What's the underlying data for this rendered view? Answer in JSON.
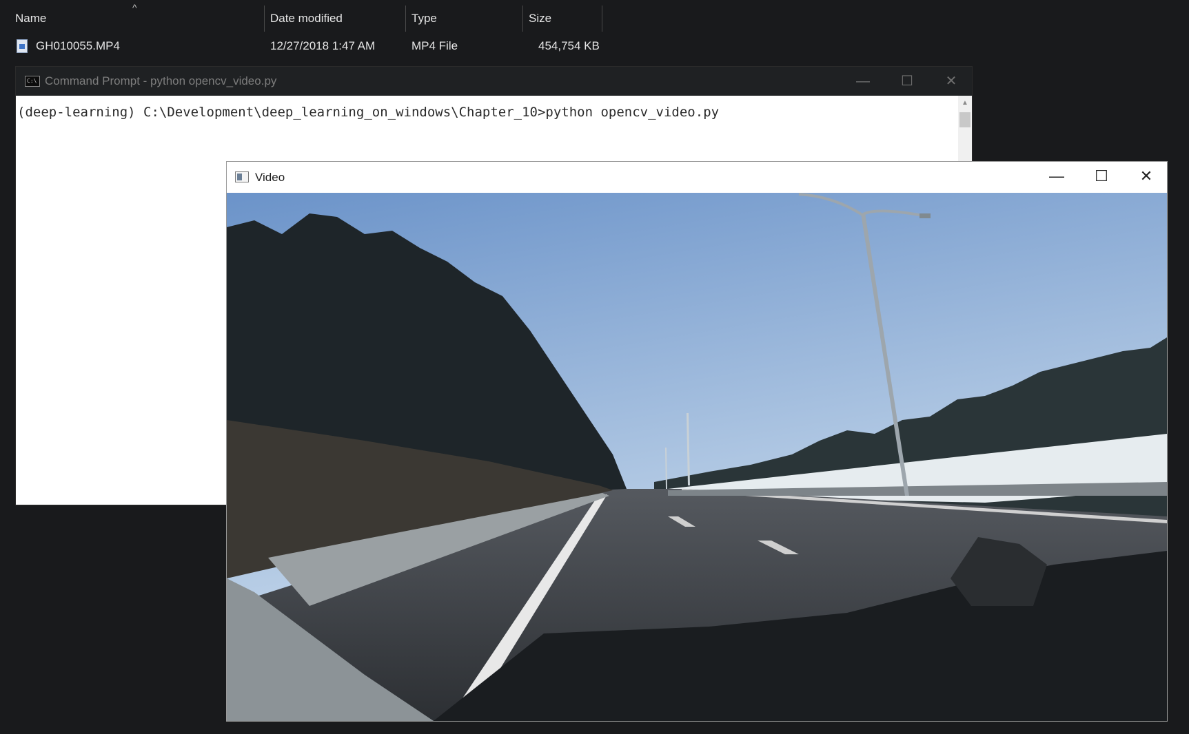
{
  "explorer": {
    "columns": {
      "name": "Name",
      "date": "Date modified",
      "type": "Type",
      "size": "Size"
    },
    "sort_indicator": "^",
    "files": [
      {
        "name": "GH010055.MP4",
        "date": "12/27/2018 1:47 AM",
        "type": "MP4 File",
        "size": "454,754 KB"
      }
    ]
  },
  "cmd_window": {
    "title": "Command Prompt - python  opencv_video.py",
    "icon_text": "C:\\",
    "prompt_line": "(deep-learning) C:\\Development\\deep_learning_on_windows\\Chapter_10>python opencv_video.py",
    "controls": {
      "minimize": "—",
      "maximize": "☐",
      "close": "✕"
    }
  },
  "video_window": {
    "title": "Video",
    "controls": {
      "minimize": "—",
      "maximize": "☐",
      "close": "✕"
    },
    "frame": {
      "scene": "dashcam highway",
      "sky_top": "#6b93c9",
      "sky_bottom": "#d8e6f2",
      "road": "#3a3e44",
      "trees": "#1e2529",
      "wall": "#e6ecef"
    }
  }
}
